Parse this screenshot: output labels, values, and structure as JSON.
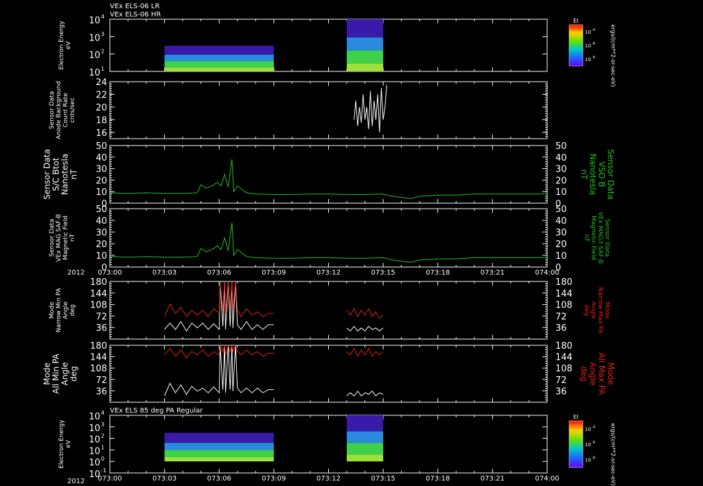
{
  "header": {
    "line1": "VEx ELS-06 LR",
    "line2": "VEx ELS-06 HR"
  },
  "footer_year": "2012",
  "time_ticks": [
    "073:00",
    "073:03",
    "073:06",
    "073:09",
    "073:12",
    "073:15",
    "073:18",
    "073:21",
    "074:00"
  ],
  "colors": {
    "field": "#22c322",
    "pa_min": "#ffffff",
    "pa_max": "#e0231b",
    "axis": "#ffffff"
  },
  "chart_data": [
    {
      "type": "heatmap",
      "ylabel": [
        "Electron Energy",
        "eV"
      ],
      "ytick_labels": [
        "10",
        "10",
        "10",
        "10"
      ],
      "ytick_exps": [
        "1",
        "2",
        "3",
        "4"
      ],
      "colorbar": {
        "title": "EI",
        "tick_labels": [
          "10",
          "10",
          "10"
        ],
        "tick_exps": [
          "-4",
          "-6",
          "-8"
        ],
        "unit": "ergs/(cm**2-sr-sec-eV)"
      },
      "blocks": [
        {
          "t_start": "073:03",
          "t_end": "073:09",
          "e_min": 10,
          "e_max": 300
        },
        {
          "t_start": "073:13",
          "t_end": "073:15",
          "e_min": 10,
          "e_max": 10000
        }
      ]
    },
    {
      "type": "line",
      "ylabel": [
        "Sensor Data",
        "Anode Background",
        "Count Rate",
        "cnts/sec"
      ],
      "yticks": [
        "16",
        "18",
        "20",
        "22",
        "24"
      ],
      "ylim": [
        15,
        24
      ],
      "series": [
        {
          "t": [
            13.4,
            13.5,
            13.6,
            13.7,
            13.8,
            13.9,
            14.0,
            14.1,
            14.2,
            14.3,
            14.4,
            14.5,
            14.6,
            14.7,
            14.8,
            14.9,
            15.0,
            15.1,
            15.2
          ],
          "values": [
            18,
            21,
            17,
            20,
            17.5,
            22,
            18,
            20,
            16.5,
            22.5,
            17,
            21,
            18,
            22,
            16,
            23,
            18,
            20,
            23.5
          ]
        }
      ]
    },
    {
      "type": "line",
      "ylabel": [
        "Sensor Data",
        "S/C Btot",
        "Nanotesla",
        "nT"
      ],
      "ylabel_right": [
        "Sensor Data",
        "VSO B",
        "Nanotesla",
        "nT"
      ],
      "yticks": [
        "0",
        "10",
        "20",
        "30",
        "40",
        "50"
      ],
      "ylim": [
        0,
        50
      ],
      "series": [
        {
          "t": [
            0,
            1,
            2,
            3,
            4,
            4.8,
            5.0,
            5.3,
            5.6,
            5.9,
            6.1,
            6.3,
            6.5,
            6.7,
            6.8,
            7.0,
            7.5,
            8,
            9,
            10,
            11,
            12,
            13,
            14,
            15,
            15.5,
            16,
            16.5,
            17,
            18,
            19,
            20,
            21,
            22,
            23,
            24
          ],
          "values": [
            9,
            8.5,
            9,
            8.5,
            8.5,
            9,
            16,
            13,
            15,
            18,
            15,
            25,
            14,
            38,
            10,
            15,
            9,
            8,
            7.5,
            7.5,
            8,
            8,
            7.5,
            7.5,
            8,
            6,
            5,
            4,
            6,
            7,
            7,
            8,
            8,
            8,
            8,
            8
          ]
        }
      ]
    },
    {
      "type": "line",
      "ylabel": [
        "Sensor Data",
        "VEx MAG SAF-B",
        "Magnetic Field",
        "nT"
      ],
      "ylabel_right": [
        "Sensor Data",
        "VEx MAG3 SAF-B",
        "Magnetic Field",
        "nT"
      ],
      "yticks": [
        "0",
        "10",
        "20",
        "30",
        "40",
        "50"
      ],
      "ylim": [
        0,
        50
      ],
      "series": [
        {
          "t": [
            0,
            1,
            2,
            3,
            4,
            4.8,
            5.0,
            5.3,
            5.6,
            5.9,
            6.1,
            6.3,
            6.5,
            6.7,
            6.8,
            7.0,
            7.5,
            8,
            9,
            10,
            11,
            12,
            13,
            14,
            15,
            15.5,
            16,
            16.5,
            17,
            18,
            19,
            20,
            21,
            22,
            23,
            24
          ],
          "values": [
            9,
            8.5,
            9,
            8.5,
            8.5,
            9,
            16,
            13,
            15,
            18,
            15,
            25,
            14,
            38,
            10,
            15,
            9,
            8,
            7.5,
            7.5,
            8,
            8,
            7.5,
            7.5,
            8,
            6,
            5,
            4,
            6,
            7,
            7,
            8,
            8,
            8,
            8,
            8
          ]
        }
      ]
    },
    {
      "type": "line",
      "ylabel": [
        "Mode",
        "Narrow Min PA",
        "Angle",
        "deg"
      ],
      "ylabel_right": [
        "Mode",
        "Narrow Max PA",
        "Angle",
        "deg"
      ],
      "yticks": [
        "36",
        "72",
        "108",
        "144",
        "180"
      ],
      "ylim": [
        0,
        180
      ],
      "series": [
        {
          "t": [
            3.0,
            3.3,
            3.6,
            3.9,
            4.2,
            4.5,
            4.8,
            5.1,
            5.4,
            5.7,
            6.0,
            6.05,
            6.2,
            6.3,
            6.35,
            6.5,
            6.6,
            6.7,
            6.75,
            6.9,
            7.0,
            7.2,
            7.5,
            7.8,
            8.1,
            8.4,
            8.7,
            9.0
          ],
          "values": [
            30,
            50,
            30,
            55,
            25,
            50,
            35,
            50,
            30,
            48,
            30,
            180,
            40,
            180,
            30,
            180,
            40,
            180,
            35,
            180,
            45,
            30,
            55,
            30,
            45,
            30,
            45,
            45
          ]
        },
        {
          "t": [
            3.0,
            3.3,
            3.6,
            3.9,
            4.2,
            4.5,
            4.8,
            5.1,
            5.4,
            5.7,
            6.0,
            6.05,
            6.2,
            6.3,
            6.35,
            6.5,
            6.6,
            6.7,
            6.75,
            6.9,
            7.0,
            7.2,
            7.5,
            7.8,
            8.1,
            8.4,
            8.7,
            9.0
          ],
          "values": [
            70,
            110,
            80,
            100,
            70,
            90,
            75,
            90,
            70,
            95,
            80,
            180,
            90,
            180,
            80,
            180,
            90,
            180,
            90,
            180,
            90,
            70,
            95,
            75,
            85,
            70,
            80,
            80
          ]
        },
        {
          "t": [
            13.0,
            13.2,
            13.4,
            13.6,
            13.8,
            14.0,
            14.2,
            14.4,
            14.6,
            14.8,
            15.0
          ],
          "values": [
            35,
            25,
            40,
            25,
            35,
            25,
            40,
            30,
            35,
            25,
            35
          ]
        },
        {
          "t": [
            13.0,
            13.2,
            13.4,
            13.6,
            13.8,
            14.0,
            14.2,
            14.4,
            14.6,
            14.8,
            15.0
          ],
          "values": [
            90,
            75,
            95,
            70,
            90,
            75,
            95,
            70,
            85,
            65,
            75
          ]
        }
      ]
    },
    {
      "type": "line",
      "ylabel": [
        "Mode",
        "All Min PA",
        "Angle",
        "deg"
      ],
      "ylabel_right": [
        "Mode",
        "All Max PA",
        "Angle",
        "deg"
      ],
      "yticks": [
        "36",
        "72",
        "108",
        "144",
        "180"
      ],
      "ylim": [
        0,
        180
      ],
      "series": [
        {
          "t": [
            3.0,
            3.3,
            3.6,
            3.9,
            4.2,
            4.5,
            4.8,
            5.1,
            5.4,
            5.7,
            6.0,
            6.05,
            6.2,
            6.3,
            6.35,
            6.5,
            6.6,
            6.7,
            6.75,
            6.9,
            7.0,
            7.2,
            7.5,
            7.8,
            8.1,
            8.4,
            8.7,
            9.0
          ],
          "values": [
            20,
            60,
            30,
            55,
            25,
            50,
            35,
            45,
            30,
            48,
            30,
            180,
            40,
            180,
            30,
            180,
            40,
            180,
            35,
            180,
            45,
            30,
            45,
            30,
            45,
            30,
            40,
            40
          ]
        },
        {
          "t": [
            3.0,
            3.3,
            3.6,
            3.9,
            4.2,
            4.5,
            4.8,
            5.1,
            5.4,
            5.7,
            6.0,
            6.05,
            6.2,
            6.3,
            6.35,
            6.5,
            6.6,
            6.7,
            6.75,
            6.9,
            7.0,
            7.2,
            7.5,
            7.8,
            8.1,
            8.4,
            8.7,
            9.0
          ],
          "values": [
            150,
            170,
            145,
            165,
            140,
            160,
            150,
            165,
            145,
            160,
            150,
            180,
            160,
            180,
            150,
            180,
            160,
            180,
            160,
            180,
            160,
            150,
            165,
            150,
            160,
            145,
            155,
            155
          ]
        },
        {
          "t": [
            13.0,
            13.2,
            13.4,
            13.6,
            13.8,
            14.0,
            14.2,
            14.4,
            14.6,
            14.8,
            15.0
          ],
          "values": [
            20,
            30,
            20,
            35,
            20,
            30,
            25,
            35,
            20,
            30,
            25
          ]
        },
        {
          "t": [
            13.0,
            13.2,
            13.4,
            13.6,
            13.8,
            14.0,
            14.2,
            14.4,
            14.6,
            14.8,
            15.0
          ],
          "values": [
            160,
            150,
            170,
            145,
            165,
            150,
            170,
            145,
            160,
            150,
            160
          ]
        }
      ]
    },
    {
      "type": "heatmap",
      "title": "VEx ELS 85 deg PA Regular",
      "ylabel": [
        "Electron Energy",
        "eV"
      ],
      "ytick_labels": [
        "10",
        "10",
        "10",
        "10",
        "10",
        "10"
      ],
      "ytick_exps": [
        "-1",
        "0",
        "1",
        "2",
        "3",
        "4"
      ],
      "colorbar": {
        "title": "EI",
        "tick_labels": [
          "10",
          "10",
          "10"
        ],
        "tick_exps": [
          "-4",
          "-6",
          "-8"
        ],
        "unit": "ergs/(cm**2-sr-sec-eV)"
      },
      "blocks": [
        {
          "t_start": "073:03",
          "t_end": "073:09",
          "e_min": 1,
          "e_max": 300
        },
        {
          "t_start": "073:13",
          "t_end": "073:15",
          "e_min": 1,
          "e_max": 10000
        }
      ]
    }
  ]
}
